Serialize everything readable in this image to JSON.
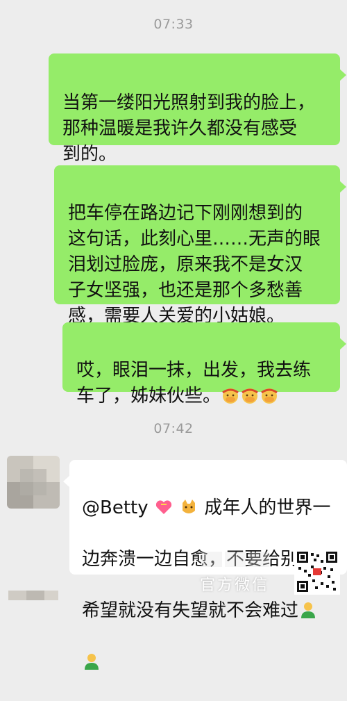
{
  "chat": {
    "time_1": "07:33",
    "time_2": "07:42",
    "messages": [
      {
        "text": "当第一缕阳光照射到我的脸上，\n那种温暖是我许久都没有感受\n到的。"
      },
      {
        "text": "把车停在路边记下刚刚想到的\n这句话，此刻心里……无声的眼\n泪划过脸庞，原来我不是女汉\n子女坚强，也还是那个多愁善\n感，需要人关爱的小姑娘。"
      },
      {
        "text": "哎，眼泪一抹，出发，我去练\n车了，姊妹伙些。"
      },
      {
        "line1": "@Betty",
        "line1_rest": "成年人的世界一",
        "line2": "边奔溃一边自愈，不要给别人",
        "line3": "希望就没有失望就不会难过"
      }
    ]
  },
  "watermark": {
    "text": "官方微信"
  },
  "colors": {
    "sent_bubble": "#95ec69",
    "recv_bubble": "#ffffff",
    "background": "#ededed"
  },
  "icons": [
    "facepalm-emoji",
    "heart-emoji",
    "cat-emoji",
    "person-emoji",
    "qr-code-icon"
  ]
}
